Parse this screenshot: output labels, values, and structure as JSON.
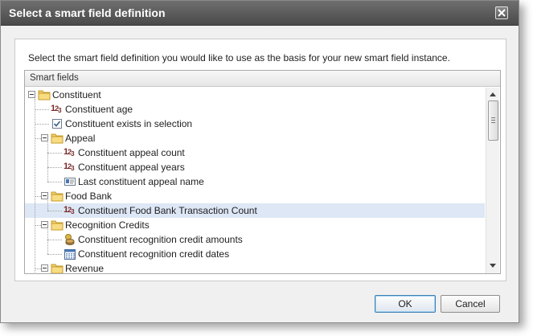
{
  "dialog": {
    "title": "Select a smart field definition",
    "close_icon": "close-icon"
  },
  "instruction": "Select the smart field definition you would like to use as the basis for your new smart field instance.",
  "tree": {
    "header": "Smart fields",
    "rows": [
      {
        "label": "Constituent",
        "type": "folder",
        "level": 0,
        "expanded": true
      },
      {
        "label": "Constituent age",
        "type": "number",
        "level": 1
      },
      {
        "label": "Constituent exists in selection",
        "type": "checkbox",
        "level": 1
      },
      {
        "label": "Appeal",
        "type": "folder",
        "level": 1,
        "expanded": true
      },
      {
        "label": "Constituent appeal count",
        "type": "number",
        "level": 2
      },
      {
        "label": "Constituent appeal years",
        "type": "number",
        "level": 2
      },
      {
        "label": "Last constituent appeal name",
        "type": "text",
        "level": 2
      },
      {
        "label": "Food Bank",
        "type": "folder",
        "level": 1,
        "expanded": true
      },
      {
        "label": "Constituent Food Bank Transaction Count",
        "type": "number",
        "level": 2,
        "selected": true
      },
      {
        "label": "Recognition Credits",
        "type": "folder",
        "level": 1,
        "expanded": true
      },
      {
        "label": "Constituent recognition credit amounts",
        "type": "currency",
        "level": 2
      },
      {
        "label": "Constituent recognition credit dates",
        "type": "date",
        "level": 2
      },
      {
        "label": "Revenue",
        "type": "folder",
        "level": 1,
        "expanded": true
      }
    ]
  },
  "buttons": {
    "ok": "OK",
    "cancel": "Cancel"
  },
  "colors": {
    "selected_row": "#dde7f5",
    "titlebar": "#5a5a5a",
    "number_icon": "#7a2a2a"
  }
}
